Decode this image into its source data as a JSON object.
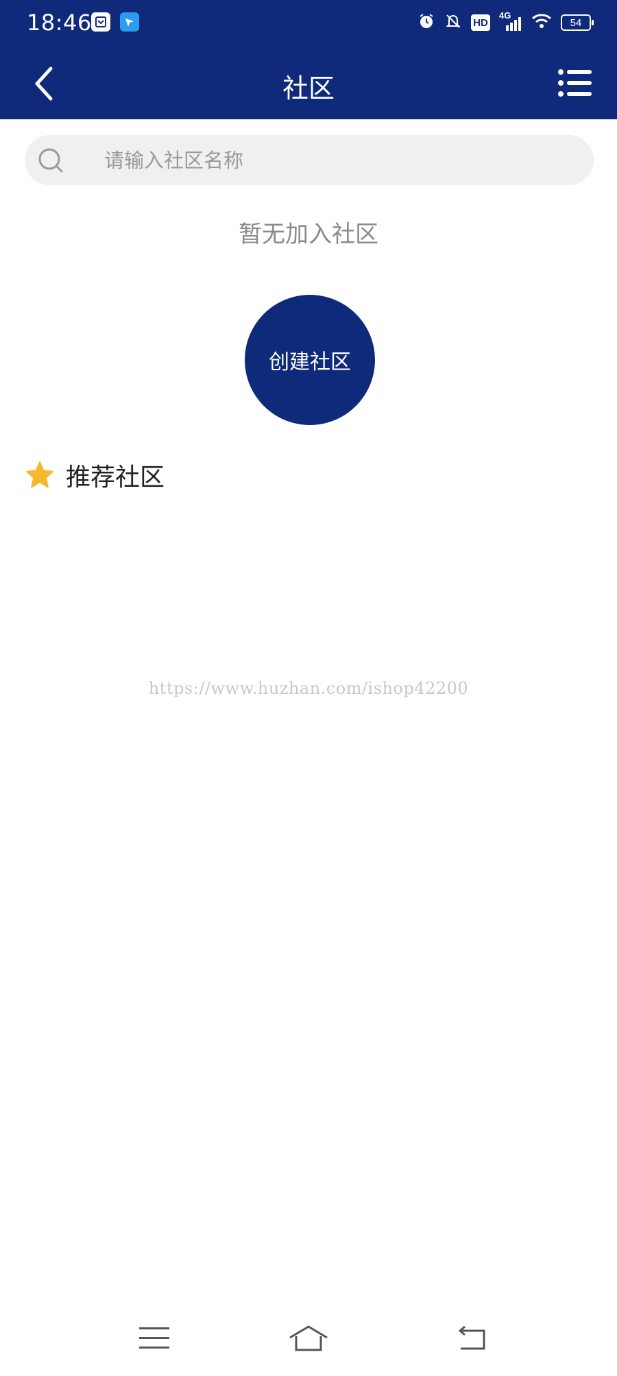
{
  "status_bar": {
    "time": "18:46",
    "network": "4G",
    "hd": "HD",
    "battery": "54"
  },
  "nav": {
    "title": "社区",
    "back_icon": "chevron-left-icon",
    "menu_icon": "list-menu-icon"
  },
  "search": {
    "placeholder": "请输入社区名称",
    "value": ""
  },
  "main": {
    "empty_text": "暂无加入社区",
    "create_button_label": "创建社区"
  },
  "recommended": {
    "title": "推荐社区",
    "icon": "star-icon"
  },
  "watermark": "https://www.huzhan.com/ishop42200",
  "colors": {
    "primary": "#0f2a7a",
    "star": "#f5b82e",
    "search_bg": "#f0f0f0"
  }
}
